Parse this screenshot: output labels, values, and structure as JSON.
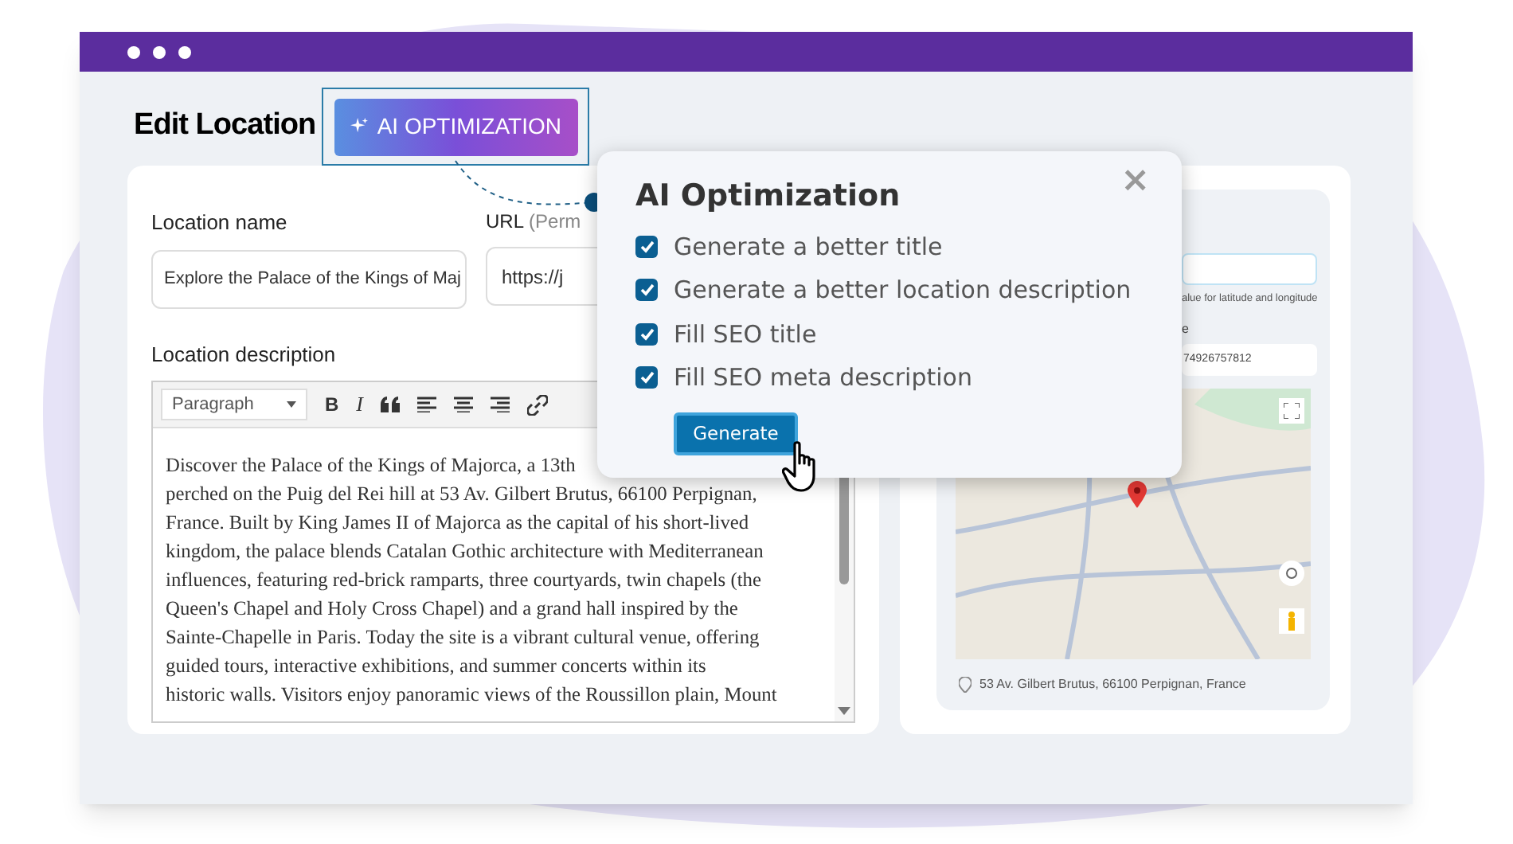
{
  "page_title": "Edit Location",
  "ai_button": {
    "label": "AI OPTIMIZATION"
  },
  "location_name": {
    "label": "Location name",
    "value": "Explore the Palace of the Kings of Maj"
  },
  "url": {
    "label": "URL",
    "hint": "(Perm",
    "value": "https://j"
  },
  "description": {
    "label": "Location description",
    "format": "Paragraph",
    "toolbar": [
      "B",
      "I"
    ],
    "lines": [
      "Discover the Palace of the Kings of Majorca, a 13th",
      "perched on the Puig del Rei hill at 53 Av. Gilbert Brutus, 66100 Perpignan,",
      "France. Built by King James II of Majorca as the capital of his short-lived",
      "kingdom, the palace blends Catalan Gothic architecture with Mediterranean",
      "influences, featuring red-brick ramparts, three courtyards, twin chapels (the",
      "Queen's Chapel and Holy Cross Chapel) and a grand hall inspired by the",
      "Sainte-Chapelle in Paris. Today the site is a vibrant cultural venue, offering",
      "guided tours, interactive exhibitions, and summer concerts within its",
      "historic walls. Visitors enjoy panoramic views of the Roussillon plain, Mount"
    ]
  },
  "location_panel": {
    "hint": "alue for latitude and longitude",
    "label": "e",
    "value": "74926757812",
    "address": "53 Av. Gilbert Brutus, 66100 Perpignan, France"
  },
  "popup": {
    "title": "AI Optimization",
    "close": "×",
    "options": [
      {
        "label": "Generate a better title",
        "checked": true
      },
      {
        "label": "Generate a better location description",
        "checked": true
      },
      {
        "label": "Fill SEO title",
        "checked": true
      },
      {
        "label": "Fill SEO meta description",
        "checked": true
      }
    ],
    "button": "Generate"
  }
}
